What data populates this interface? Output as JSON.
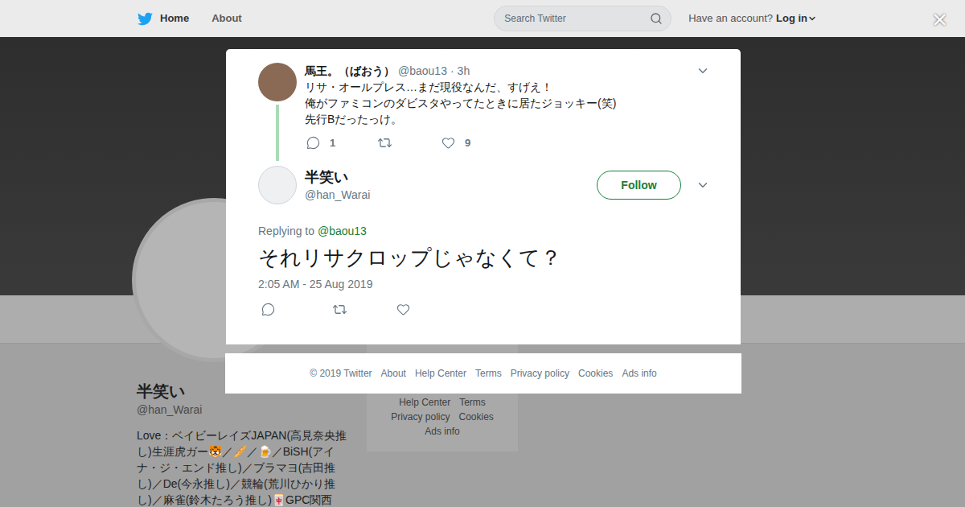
{
  "nav": {
    "items": [
      {
        "label": "Home",
        "selected": true
      },
      {
        "label": "About",
        "selected": false
      }
    ],
    "search": {
      "placeholder": "Search Twitter"
    },
    "account_prompt": "Have an account?",
    "login": "Log in",
    "close": "×"
  },
  "profile": {
    "name": "半笑い",
    "handle": "@han_Warai",
    "bio": "Love：ベイビーレイズJAPAN(高見奈央推し)生涯虎ガー🐯／🥖／🍺／BiSH(アイナ・ジ・エンド推し)／ブラマヨ(吉田推し)／De(今永推し)／競輪(荒川ひかり推し)／麻雀(鈴木たろう推し)🀄GPC関西",
    "footer_links": [
      [
        "Help Center",
        "Terms"
      ],
      [
        "Privacy policy",
        "Cookies"
      ],
      [
        "Ads info"
      ]
    ]
  },
  "modal": {
    "parent_tweet": {
      "name": "馬王。（ばおう）",
      "handle": "@baou13",
      "separator": "·",
      "time": "3h",
      "lines": [
        "リサ・オールプレス…まだ現役なんだ、すげえ！",
        "俺がファミコンのダビスタやってたときに居たジョッキー(笑)",
        "先行Bだったっけ。"
      ],
      "replies": "1",
      "likes": "9"
    },
    "tweet": {
      "name": "半笑い",
      "handle": "@han_Warai",
      "follow": "Follow",
      "replying_label": "Replying to",
      "replying_handle": "@baou13",
      "text": "それリサクロップじゃなくて？",
      "timestamp": "2:05 AM - 25 Aug 2019"
    }
  },
  "modal_footer": {
    "copyright": "© 2019 Twitter",
    "links": [
      "About",
      "Help Center",
      "Terms",
      "Privacy policy",
      "Cookies",
      "Ads info"
    ]
  }
}
